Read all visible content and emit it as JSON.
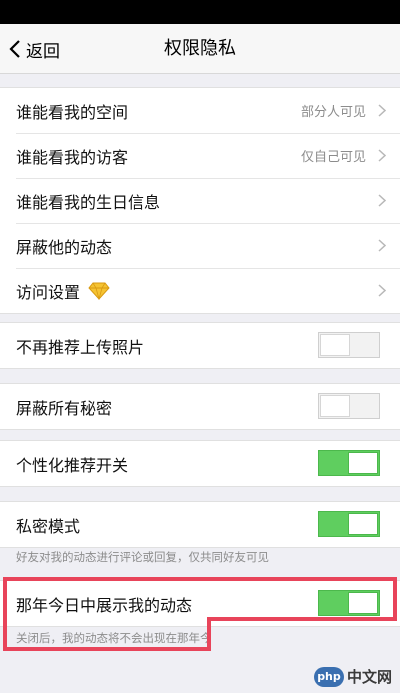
{
  "nav": {
    "back_label": "返回",
    "title": "权限隐私"
  },
  "group1": {
    "items": [
      {
        "label": "谁能看我的空间",
        "value": "部分人可见"
      },
      {
        "label": "谁能看我的访客",
        "value": "仅自己可见"
      },
      {
        "label": "谁能看我的生日信息",
        "value": ""
      },
      {
        "label": "屏蔽他的动态",
        "value": ""
      },
      {
        "label": "访问设置",
        "value": ""
      }
    ]
  },
  "toggles": [
    {
      "label": "不再推荐上传照片",
      "state": "off"
    },
    {
      "label": "屏蔽所有秘密",
      "state": "off"
    },
    {
      "label": "个性化推荐开关",
      "state": "on"
    },
    {
      "label": "私密模式",
      "state": "on"
    },
    {
      "label": "那年今日中展示我的动态",
      "state": "on"
    }
  ],
  "hints": {
    "private_mode": "好友对我的动态进行评论或回复，仅共同好友可见",
    "on_this_day": "关闭后，我的动态将不会出现在那年今"
  },
  "watermark": {
    "logo": "php",
    "text": "中文网"
  },
  "colors": {
    "toggle_on": "#5fce5f",
    "highlight": "#e8445a",
    "background": "#efeff4"
  }
}
